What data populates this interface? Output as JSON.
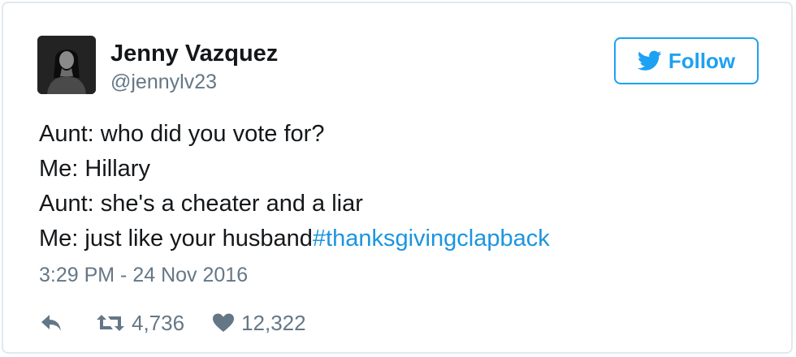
{
  "user": {
    "display_name": "Jenny Vazquez",
    "handle": "@jennylv23"
  },
  "follow_button": {
    "label": "Follow"
  },
  "tweet": {
    "lines": [
      "Aunt: who did you vote for?",
      "Me: Hillary",
      "Aunt: she's a cheater and a liar",
      "Me: just like your husband"
    ],
    "hashtag": "#thanksgivingclapback",
    "timestamp": "3:29 PM - 24 Nov 2016"
  },
  "actions": {
    "retweet_count": "4,736",
    "like_count": "12,322"
  },
  "colors": {
    "brand_blue": "#1da1f2",
    "link_blue": "#1b95e0",
    "secondary_text": "#657786",
    "border": "#e1e8ed"
  },
  "icons": {
    "follow": "twitter-bird-icon",
    "reply": "reply-arrow-icon",
    "retweet": "retweet-icon",
    "like": "heart-icon"
  }
}
